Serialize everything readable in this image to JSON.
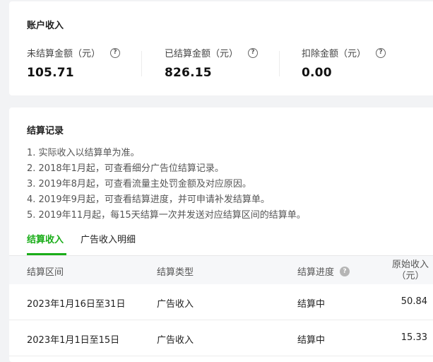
{
  "income": {
    "title": "账户收入",
    "metrics": [
      {
        "label": "未结算金额（元）",
        "value": "105.71"
      },
      {
        "label": "已结算金额（元）",
        "value": "826.15"
      },
      {
        "label": "扣除金额（元）",
        "value": "0.00"
      }
    ]
  },
  "records": {
    "title": "结算记录",
    "notes": [
      "1. 实际收入以结算单为准。",
      "2. 2018年1月起，可查看细分广告位结算记录。",
      "3. 2019年8月起，可查看流量主处罚金额及对应原因。",
      "4. 2019年9月起，可查看结算进度，并可申请补发结算单。",
      "5. 2019年11月起，每15天结算一次并发送对应结算区间的结算单。"
    ],
    "tabs": [
      {
        "label": "结算收入",
        "active": true
      },
      {
        "label": "广告收入明细",
        "active": false
      }
    ],
    "columns": {
      "period": "结算区间",
      "type": "结算类型",
      "progress": "结算进度",
      "original_line1": "原始收入",
      "original_line2": "（元）"
    },
    "rows": [
      {
        "period": "2023年1月16日至31日",
        "type": "广告收入",
        "progress": "结算中",
        "original": "50.84"
      },
      {
        "period": "2023年1月1日至15日",
        "type": "广告收入",
        "progress": "结算中",
        "original": "15.33"
      }
    ]
  },
  "colors": {
    "accent": "#1aad19",
    "background": "#f2f3f5"
  },
  "icons": {
    "help": "question-circle-icon"
  }
}
